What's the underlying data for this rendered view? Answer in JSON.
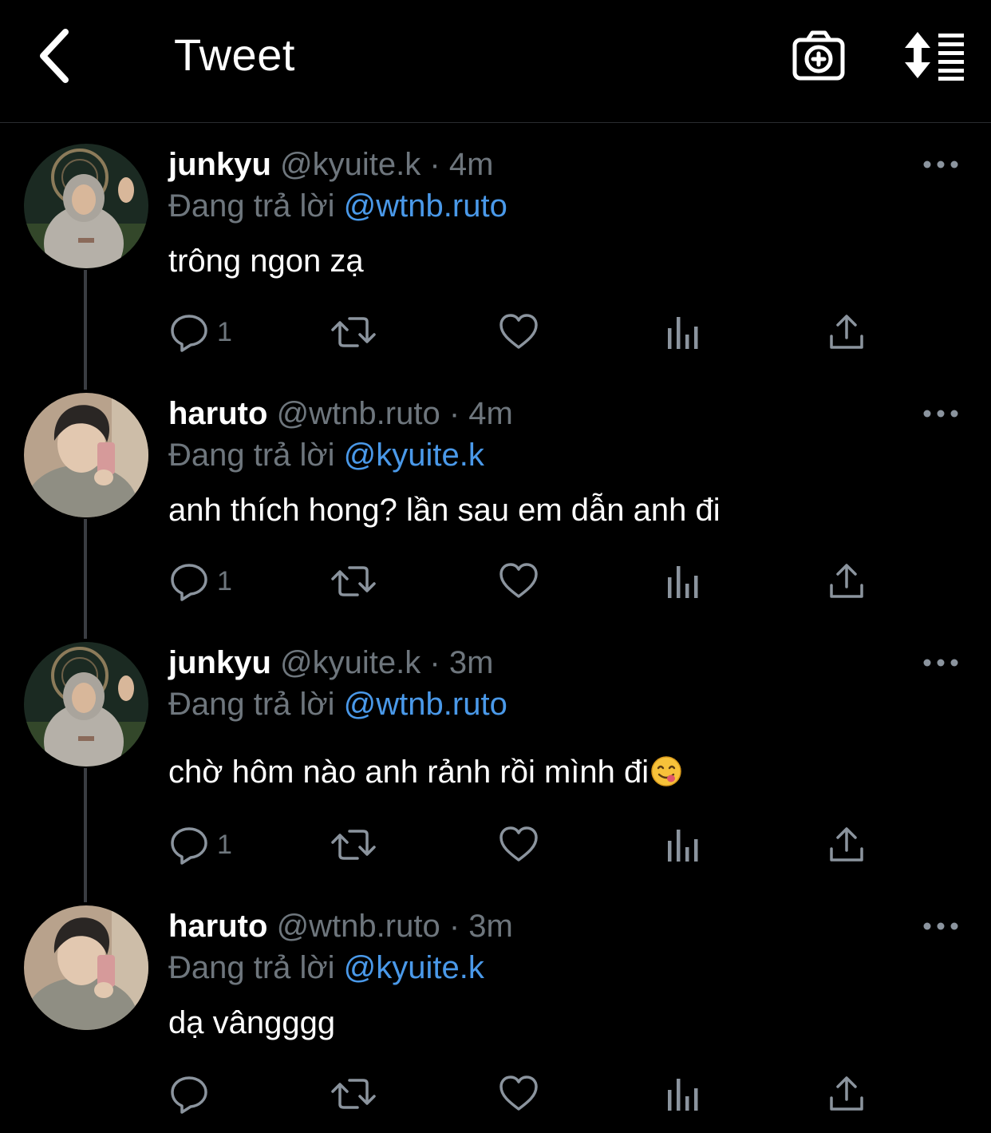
{
  "header": {
    "title": "Tweet",
    "back_icon": "chevron-left-icon",
    "camera_icon": "camera-plus-icon",
    "sort_icon": "sort-list-icon"
  },
  "colors": {
    "background": "#000000",
    "text": "#ffffff",
    "muted": "#6e767d",
    "accent": "#4a99e9",
    "thread_line": "#3a3d42"
  },
  "tweets": [
    {
      "name": "junkyu",
      "handle": "@kyuite.k",
      "separator": "·",
      "time": "4m",
      "replying_label": "Đang trả lời",
      "replying_to": "@wtnb.ruto",
      "text": "trông ngon zạ",
      "reply_count": "1",
      "emoji": ""
    },
    {
      "name": "haruto",
      "handle": "@wtnb.ruto",
      "separator": "·",
      "time": "4m",
      "replying_label": "Đang trả lời",
      "replying_to": "@kyuite.k",
      "text": "anh thích hong? lần sau em dẫn anh đi",
      "reply_count": "1",
      "emoji": ""
    },
    {
      "name": "junkyu",
      "handle": "@kyuite.k",
      "separator": "·",
      "time": "3m",
      "replying_label": "Đang trả lời",
      "replying_to": "@wtnb.ruto",
      "text": "chờ hôm nào anh rảnh rồi mình đi",
      "reply_count": "1",
      "emoji": "face-savoring-food"
    },
    {
      "name": "haruto",
      "handle": "@wtnb.ruto",
      "separator": "·",
      "time": "3m",
      "replying_label": "Đang trả lời",
      "replying_to": "@kyuite.k",
      "text": "dạ vângggg",
      "reply_count": "",
      "emoji": ""
    }
  ],
  "action_icons": [
    "reply-icon",
    "retweet-icon",
    "like-icon",
    "analytics-icon",
    "share-icon"
  ]
}
